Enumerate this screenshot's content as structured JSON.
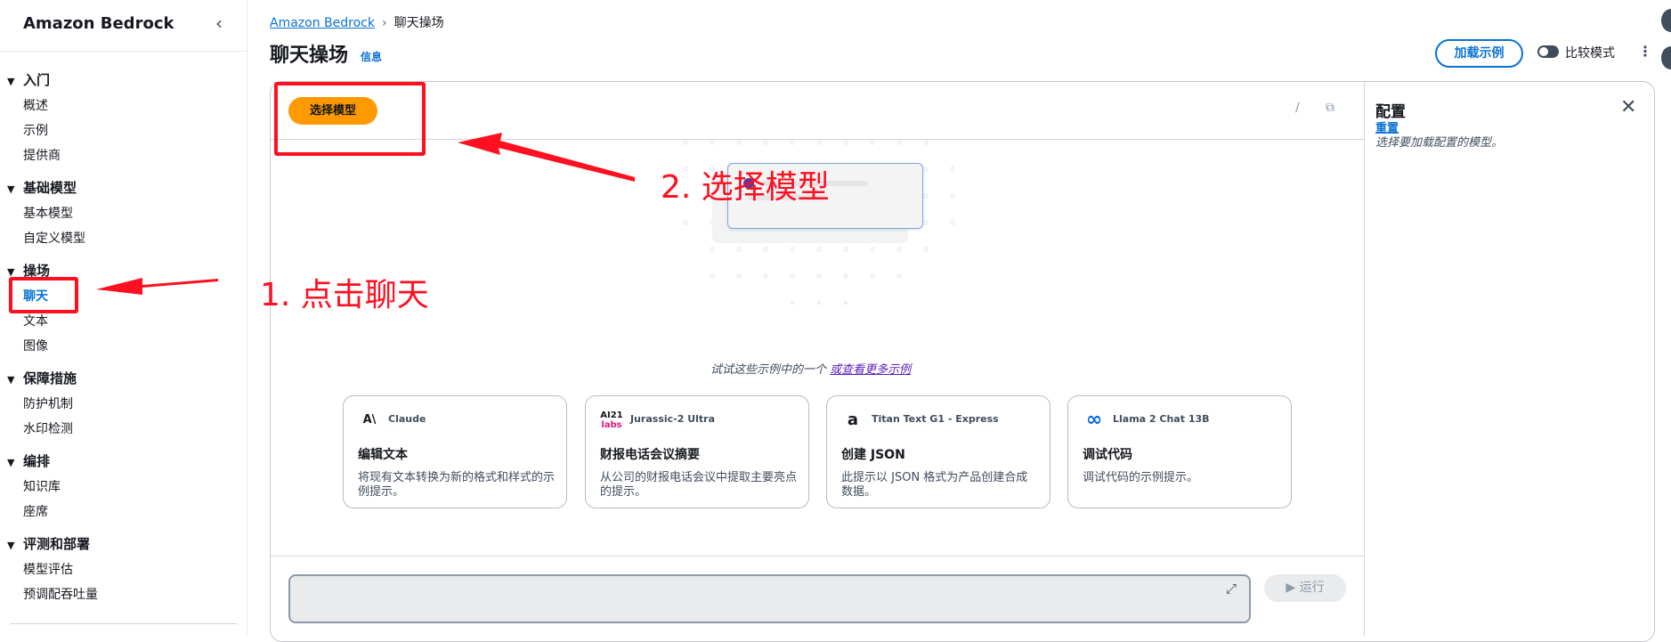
{
  "sidebar": {
    "title": "Amazon Bedrock",
    "sections": [
      {
        "label": "入门",
        "items": [
          "概述",
          "示例",
          "提供商"
        ]
      },
      {
        "label": "基础模型",
        "items": [
          "基本模型",
          "自定义模型"
        ]
      },
      {
        "label": "操场",
        "items": [
          "聊天",
          "文本",
          "图像"
        ]
      },
      {
        "label": "保障措施",
        "items": [
          "防护机制",
          "水印检测"
        ]
      },
      {
        "label": "编排",
        "items": [
          "知识库",
          "座席"
        ]
      },
      {
        "label": "评测和部署",
        "items": [
          "模型评估",
          "预调配吞吐量"
        ]
      }
    ],
    "active_item": "聊天"
  },
  "header": {
    "breadcrumb_root": "Amazon Bedrock",
    "breadcrumb_current": "聊天操场",
    "title": "聊天操场",
    "info": "信息",
    "load_examples": "加载示例",
    "compare_mode": "比较模式",
    "compare_mode_on": false
  },
  "chat": {
    "select_model": "选择模型",
    "examples_prompt": "试试这些示例中的一个",
    "examples_link": "或查看更多示例",
    "cards": [
      {
        "provider_logo": "AI",
        "model": "Claude",
        "title": "编辑文本",
        "desc": "将现有文本转换为新的格式和样式的示例提示。"
      },
      {
        "provider_logo": "AI21 labs",
        "model": "Jurassic-2 Ultra",
        "title": "财报电话会议摘要",
        "desc": "从公司的财报电话会议中提取主要亮点的提示。"
      },
      {
        "provider_logo": "a",
        "model": "Titan Text G1 - Express",
        "title": "创建 JSON",
        "desc": "此提示以 JSON 格式为产品创建合成数据。"
      },
      {
        "provider_logo": "∞",
        "model": "Llama 2 Chat 13B",
        "title": "调试代码",
        "desc": "调试代码的示例提示。"
      }
    ],
    "run": "运行"
  },
  "config": {
    "title": "配置",
    "reset": "重置",
    "desc": "选择要加载配置的模型。"
  },
  "annotations": {
    "step1": "1. 点击聊天",
    "step2": "2. 选择模型",
    "color": "#ff0f1f"
  },
  "colors": {
    "accent": "#0972d3",
    "primary_button": "#ff9900",
    "annotation": "#ff0f1f"
  }
}
